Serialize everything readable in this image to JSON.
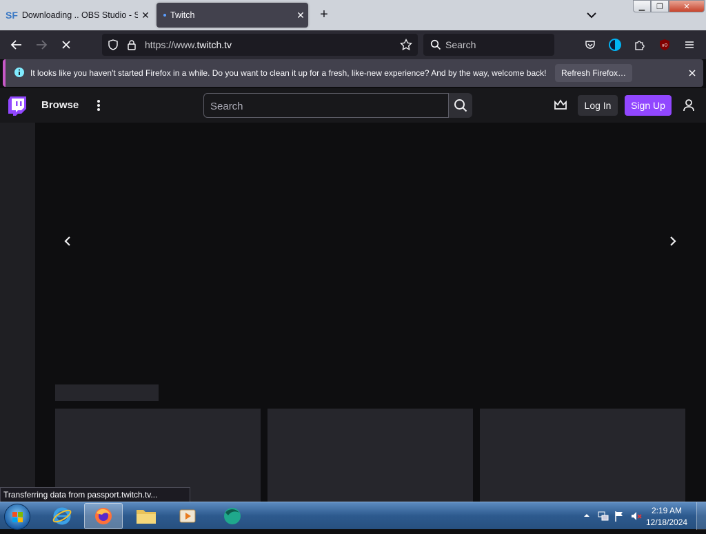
{
  "browser": {
    "tabs": [
      {
        "label": "Downloading .. OBS Studio - Sc",
        "icon": "sourceforge-icon",
        "active": false
      },
      {
        "label": "Twitch",
        "icon": "loading-dot-icon",
        "active": true
      }
    ],
    "url": {
      "prefix": "https://www.",
      "host": "twitch.tv"
    },
    "search_placeholder": "Search"
  },
  "notification": {
    "message": "It looks like you haven't started Firefox in a while. Do you want to clean it up for a fresh, like-new experience? And by the way, welcome back!",
    "button_label": "Refresh Firefox…"
  },
  "twitch": {
    "browse_label": "Browse",
    "search_placeholder": "Search",
    "login_label": "Log In",
    "signup_label": "Sign Up",
    "accent_color": "#9147ff"
  },
  "status_text": "Transferring data from passport.twitch.tv...",
  "taskbar": {
    "time": "2:19 AM",
    "date": "12/18/2024"
  }
}
